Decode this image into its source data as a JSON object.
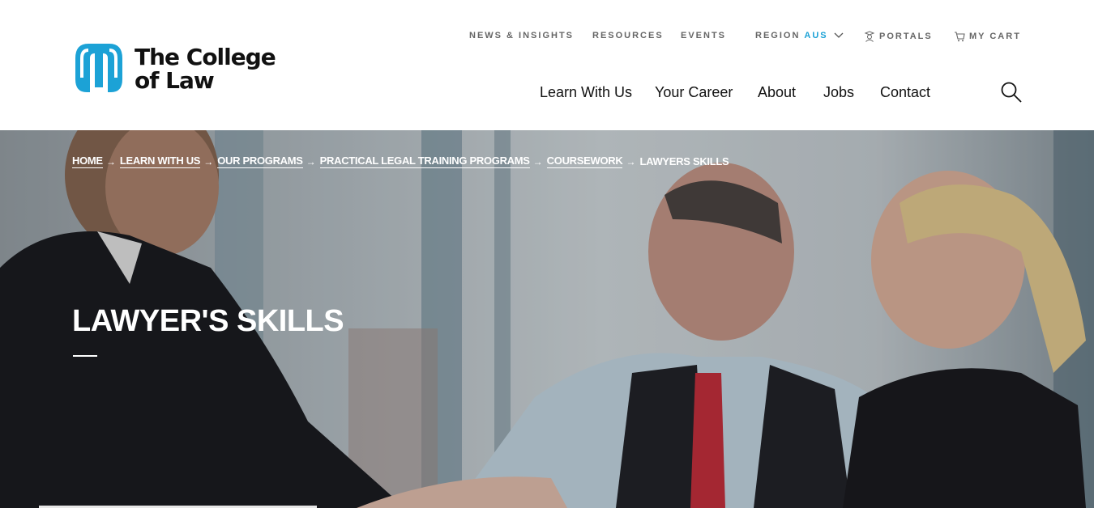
{
  "brand": {
    "name_line1": "The College",
    "name_line2": "of Law",
    "logo_color": "#1ca2d6"
  },
  "utility_nav": {
    "news": "NEWS & INSIGHTS",
    "resources": "RESOURCES",
    "events": "EVENTS",
    "region_label": "REGION",
    "region_value": "AUS",
    "portals": "PORTALS",
    "cart": "MY CART"
  },
  "main_nav": {
    "items": [
      "Learn With Us",
      "Your Career",
      "About",
      "Jobs",
      "Contact"
    ]
  },
  "breadcrumb": {
    "items": [
      "HOME",
      "LEARN WITH US",
      "OUR PROGRAMS",
      "PRACTICAL LEGAL TRAINING PROGRAMS",
      "COURSEWORK",
      "LAWYERS SKILLS"
    ],
    "separator": "→"
  },
  "hero": {
    "title": "LAWYER'S SKILLS"
  },
  "icons": {
    "logo": "college-logo-icon",
    "chevron": "chevron-down-icon",
    "portals": "graduate-icon",
    "cart": "cart-icon",
    "search": "search-icon",
    "arrow": "arrow-right-icon"
  }
}
